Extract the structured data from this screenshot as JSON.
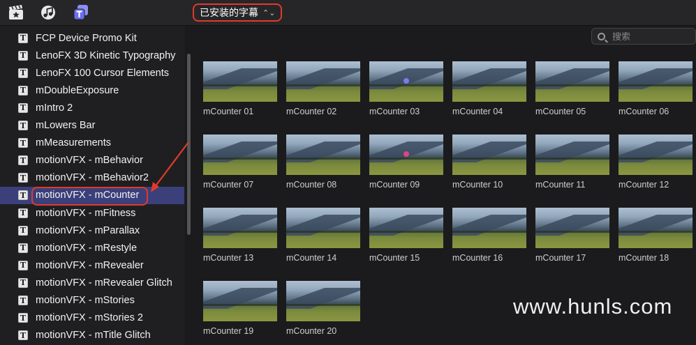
{
  "toolbar": {
    "icons": [
      "clapper-star-icon",
      "music-notes-icon",
      "titles-icon"
    ],
    "dropdown_label": "已安装的字幕",
    "dropdown_chevron": "⌃⌄"
  },
  "search": {
    "placeholder": "搜索"
  },
  "sidebar": {
    "items": [
      {
        "icon": "T",
        "label": "FCP Device Promo Kit"
      },
      {
        "icon": "T",
        "label": "LenoFX 3D Kinetic Typography"
      },
      {
        "icon": "T",
        "label": "LenoFX 100 Cursor Elements"
      },
      {
        "icon": "T",
        "label": "mDoubleExposure"
      },
      {
        "icon": "T",
        "label": "mIntro 2"
      },
      {
        "icon": "T",
        "label": "mLowers Bar"
      },
      {
        "icon": "T",
        "label": "mMeasurements"
      },
      {
        "icon": "T",
        "label": "motionVFX - mBehavior"
      },
      {
        "icon": "T",
        "label": "motionVFX - mBehavior2"
      },
      {
        "icon": "T",
        "label": "motionVFX - mCounter"
      },
      {
        "icon": "T",
        "label": "motionVFX - mFitness"
      },
      {
        "icon": "T",
        "label": "motionVFX - mParallax"
      },
      {
        "icon": "T",
        "label": "motionVFX - mRestyle"
      },
      {
        "icon": "T",
        "label": "motionVFX - mRevealer"
      },
      {
        "icon": "T",
        "label": "motionVFX - mRevealer Glitch"
      },
      {
        "icon": "T",
        "label": "motionVFX - mStories"
      },
      {
        "icon": "T",
        "label": "motionVFX - mStories 2"
      },
      {
        "icon": "T",
        "label": "motionVFX - mTitle Glitch"
      }
    ],
    "selected_index": 9
  },
  "thumbnails": [
    "mCounter 01",
    "mCounter 02",
    "mCounter 03",
    "mCounter 04",
    "mCounter 05",
    "mCounter 06",
    "mCounter 07",
    "mCounter 08",
    "mCounter 09",
    "mCounter 10",
    "mCounter 11",
    "mCounter 12",
    "mCounter 13",
    "mCounter 14",
    "mCounter 15",
    "mCounter 16",
    "mCounter 17",
    "mCounter 18",
    "mCounter 19",
    "mCounter 20"
  ],
  "watermark": "www.hunls.com",
  "colors": {
    "highlight": "#e03a2c",
    "selection": "#3b3f7a",
    "titles_icon": "#6a6ef0"
  }
}
